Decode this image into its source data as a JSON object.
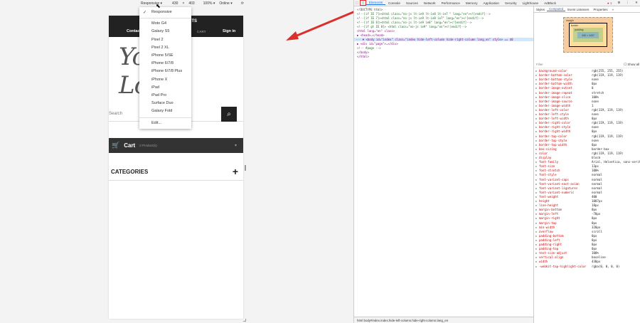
{
  "devbar": {
    "device": "Responsive",
    "width": "430",
    "x": "×",
    "height": "403",
    "zoom": "100%",
    "throttle": "Online"
  },
  "dropdown": {
    "items": [
      "Responsive",
      "Moto G4",
      "Galaxy S5",
      "Pixel 2",
      "Pixel 2 XL",
      "iPhone 5/SE",
      "iPhone 6/7/8",
      "iPhone 6/7/8 Plus",
      "iPhone X",
      "iPad",
      "iPad Pro",
      "Surface Duo",
      "Galaxy Fold",
      "Edit..."
    ],
    "check": "✓"
  },
  "site": {
    "contact": "Contact",
    "products": "CTS",
    "call": "CART",
    "signin": "Sign in",
    "logo": "Your Logo",
    "search_placeholder": "Search",
    "cart": "Cart",
    "cart_count": "0 Product(s)",
    "categories": "CATEGORIES",
    "plus": "+"
  },
  "devtools": {
    "tabs": [
      "Elements",
      "Console",
      "Sources",
      "Network",
      "Performance",
      "Memory",
      "Application",
      "Security",
      "Lighthouse",
      "AdBlock"
    ],
    "side_tabs": [
      "Styles",
      "Computed",
      "Event Listeners",
      "Properties"
    ],
    "filter": "Filter",
    "show_all": "Show all",
    "code": [
      "<!DOCTYPE html>",
      "<!--[if IE 7]><html class=\"no-js lt-ie9 lt-ie8 lt-ie7 \" lang=\"en\"><![endif]-->",
      "<!--[if IE 7]><html class=\"no-js lt-ie9 lt-ie8 ie7\" lang=\"en\"><![endif]-->",
      "<!--[if IE 8]><html class=\"no-js lt-ie9 ie8\" lang=\"en\"><![endif]-->",
      "<!--[if gt IE 8]> <html class=\"no-js ie9\" lang=\"en\"><![endif]-->",
      "<html lang=\"en\" class>",
      "  ▶ <head>…</head>",
      "··· ▼ <body id=\"index\" class=\"index hide-left-column hide-right-column lang_en\" style> == $0",
      "    ▶ <div id=\"page\">…</div>",
      "      <!-- #page -->",
      "    </body>",
      "  </html>"
    ],
    "breadcrumb": "html   body#index.index.hide-left-column.hide-right-column.lang_en",
    "box": {
      "margin": "margin",
      "border": "border",
      "padding": "padding",
      "content": "430 × 1007"
    },
    "props": [
      [
        "background-color",
        "rgb(255, 255, 255)"
      ],
      [
        "border-bottom-color",
        "rgb(119, 119, 119)"
      ],
      [
        "border-bottom-style",
        "none"
      ],
      [
        "border-bottom-width",
        "0px"
      ],
      [
        "border-image-outset",
        "0"
      ],
      [
        "border-image-repeat",
        "stretch"
      ],
      [
        "border-image-slice",
        "100%"
      ],
      [
        "border-image-source",
        "none"
      ],
      [
        "border-image-width",
        "1"
      ],
      [
        "border-left-color",
        "rgb(119, 119, 119)"
      ],
      [
        "border-left-style",
        "none"
      ],
      [
        "border-left-width",
        "0px"
      ],
      [
        "border-right-color",
        "rgb(119, 119, 119)"
      ],
      [
        "border-right-style",
        "none"
      ],
      [
        "border-right-width",
        "0px"
      ],
      [
        "border-top-color",
        "rgb(119, 119, 119)"
      ],
      [
        "border-top-style",
        "none"
      ],
      [
        "border-top-width",
        "0px"
      ],
      [
        "box-sizing",
        "border-box"
      ],
      [
        "color",
        "rgb(119, 119, 119)"
      ],
      [
        "display",
        "block"
      ],
      [
        "font-family",
        "Arial, Helvetica, sans-serif"
      ],
      [
        "font-size",
        "13px"
      ],
      [
        "font-stretch",
        "100%"
      ],
      [
        "font-style",
        "normal"
      ],
      [
        "font-variant-caps",
        "normal"
      ],
      [
        "font-variant-east-asian",
        "normal"
      ],
      [
        "font-variant-ligatures",
        "normal"
      ],
      [
        "font-variant-numeric",
        "normal"
      ],
      [
        "font-weight",
        "400"
      ],
      [
        "height",
        "1007px"
      ],
      [
        "line-height",
        "18px"
      ],
      [
        "margin-bottom",
        "0px"
      ],
      [
        "margin-left",
        "-70px"
      ],
      [
        "margin-right",
        "0px"
      ],
      [
        "margin-top",
        "0px"
      ],
      [
        "min-width",
        "320px"
      ],
      [
        "overflow",
        "scroll"
      ],
      [
        "padding-bottom",
        "0px"
      ],
      [
        "padding-left",
        "0px"
      ],
      [
        "padding-right",
        "0px"
      ],
      [
        "padding-top",
        "0px"
      ],
      [
        "text-size-adjust",
        "100%"
      ],
      [
        "vertical-align",
        "baseline"
      ],
      [
        "width",
        "430px"
      ],
      [
        "-webkit-tap-highlight-color",
        "rgba(0, 0, 0, 0)"
      ]
    ]
  },
  "colors": {
    "arrow": "#d9302c",
    "highlight": "#cfe8fc",
    "dark": "#222222"
  }
}
